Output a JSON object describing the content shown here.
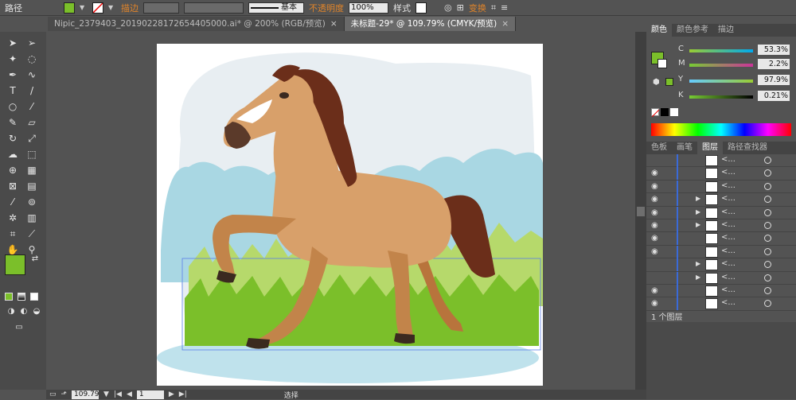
{
  "control_bar": {
    "path_label": "路径",
    "fill_color": "#7bbf2a",
    "stroke_label": "描边",
    "stroke_style": "基本",
    "opacity_label": "不透明度",
    "opacity_value": "100%",
    "style_label": "样式",
    "transform_label": "变换"
  },
  "tabs": [
    {
      "label": "Nipic_2379403_20190228172654405000.ai* @ 200% (RGB/预览)",
      "active": false
    },
    {
      "label": "未标题-29* @ 109.79% (CMYK/预览)",
      "active": true
    }
  ],
  "color_panel": {
    "tabs": [
      "颜色",
      "颜色参考",
      "描边"
    ],
    "swatch": "#7bbf2a",
    "channels": [
      {
        "label": "C",
        "value": "53.3%"
      },
      {
        "label": "M",
        "value": "2.2%"
      },
      {
        "label": "Y",
        "value": "97.9%"
      },
      {
        "label": "K",
        "value": "0.21%"
      }
    ]
  },
  "layers_panel": {
    "tabs": [
      "色板",
      "画笔",
      "图层",
      "路径查找器"
    ],
    "rows": [
      "<...",
      "<...",
      "<...",
      "<...",
      "<...",
      "<...",
      "<...",
      "<...",
      "<...",
      "<...",
      "<...",
      "<..."
    ],
    "footer": "1 个图层"
  },
  "status": {
    "zoom": "109.79",
    "page": "1",
    "tool": "选择"
  },
  "icons": [
    "select-arrow-icon",
    "direct-select-icon",
    "magic-wand-icon",
    "lasso-icon",
    "pen-icon",
    "curvature-icon",
    "type-icon",
    "line-icon",
    "ellipse-icon",
    "brush-icon",
    "pencil-icon",
    "eraser-icon",
    "rotate-icon",
    "scale-icon",
    "warp-icon",
    "free-transform-icon",
    "shape-builder-icon",
    "perspective-icon",
    "mesh-icon",
    "gradient-icon",
    "eyedropper-icon",
    "blend-icon",
    "symbol-sprayer-icon",
    "column-graph-icon",
    "artboard-icon",
    "slice-icon",
    "hand-icon",
    "zoom-icon"
  ]
}
